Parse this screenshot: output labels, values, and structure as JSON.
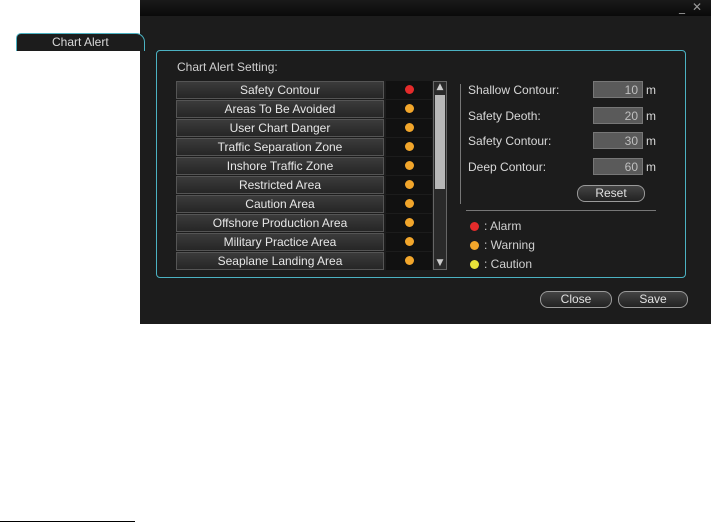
{
  "window": {
    "minimize_glyph": "_",
    "close_glyph": "✕"
  },
  "tab": {
    "label": "Chart Alert"
  },
  "section": {
    "label": "Chart Alert Setting:"
  },
  "alerts": [
    {
      "name": "Safety Contour",
      "level": "alarm"
    },
    {
      "name": "Areas To Be Avoided",
      "level": "warning"
    },
    {
      "name": "User Chart Danger",
      "level": "warning"
    },
    {
      "name": "Traffic Separation Zone",
      "level": "warning"
    },
    {
      "name": "Inshore Traffic Zone",
      "level": "warning"
    },
    {
      "name": "Restricted Area",
      "level": "warning"
    },
    {
      "name": "Caution Area",
      "level": "warning"
    },
    {
      "name": "Offshore Production Area",
      "level": "warning"
    },
    {
      "name": "Military Practice Area",
      "level": "warning"
    },
    {
      "name": "Seaplane Landing Area",
      "level": "warning"
    }
  ],
  "colors": {
    "alarm": "#e52b2b",
    "warning": "#f2a62b",
    "caution": "#e8e23a"
  },
  "depths": {
    "shallow": {
      "label": "Shallow Contour:",
      "value": "10",
      "unit": "m"
    },
    "safety_depth": {
      "label": "Safety Deoth:",
      "value": "20",
      "unit": "m"
    },
    "safety_contour": {
      "label": "Safety Contour:",
      "value": "30",
      "unit": "m"
    },
    "deep": {
      "label": "Deep Contour:",
      "value": "60",
      "unit": "m"
    }
  },
  "buttons": {
    "reset": "Reset",
    "close": "Close",
    "save": "Save"
  },
  "legend": {
    "alarm": ": Alarm",
    "warning": ": Warning",
    "caution": ": Caution"
  }
}
